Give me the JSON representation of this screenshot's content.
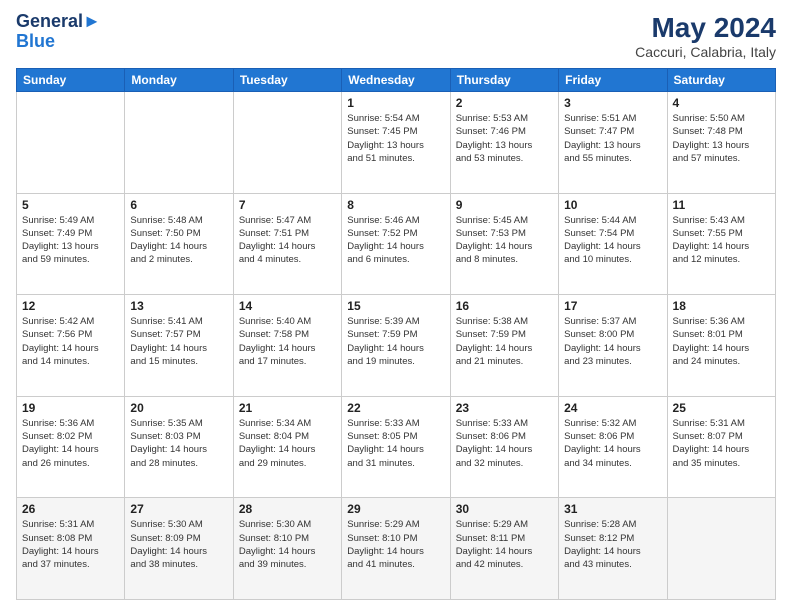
{
  "header": {
    "logo_line1": "General",
    "logo_line2": "Blue",
    "month_year": "May 2024",
    "location": "Caccuri, Calabria, Italy"
  },
  "weekdays": [
    "Sunday",
    "Monday",
    "Tuesday",
    "Wednesday",
    "Thursday",
    "Friday",
    "Saturday"
  ],
  "weeks": [
    [
      {
        "day": "",
        "info": ""
      },
      {
        "day": "",
        "info": ""
      },
      {
        "day": "",
        "info": ""
      },
      {
        "day": "1",
        "info": "Sunrise: 5:54 AM\nSunset: 7:45 PM\nDaylight: 13 hours\nand 51 minutes."
      },
      {
        "day": "2",
        "info": "Sunrise: 5:53 AM\nSunset: 7:46 PM\nDaylight: 13 hours\nand 53 minutes."
      },
      {
        "day": "3",
        "info": "Sunrise: 5:51 AM\nSunset: 7:47 PM\nDaylight: 13 hours\nand 55 minutes."
      },
      {
        "day": "4",
        "info": "Sunrise: 5:50 AM\nSunset: 7:48 PM\nDaylight: 13 hours\nand 57 minutes."
      }
    ],
    [
      {
        "day": "5",
        "info": "Sunrise: 5:49 AM\nSunset: 7:49 PM\nDaylight: 13 hours\nand 59 minutes."
      },
      {
        "day": "6",
        "info": "Sunrise: 5:48 AM\nSunset: 7:50 PM\nDaylight: 14 hours\nand 2 minutes."
      },
      {
        "day": "7",
        "info": "Sunrise: 5:47 AM\nSunset: 7:51 PM\nDaylight: 14 hours\nand 4 minutes."
      },
      {
        "day": "8",
        "info": "Sunrise: 5:46 AM\nSunset: 7:52 PM\nDaylight: 14 hours\nand 6 minutes."
      },
      {
        "day": "9",
        "info": "Sunrise: 5:45 AM\nSunset: 7:53 PM\nDaylight: 14 hours\nand 8 minutes."
      },
      {
        "day": "10",
        "info": "Sunrise: 5:44 AM\nSunset: 7:54 PM\nDaylight: 14 hours\nand 10 minutes."
      },
      {
        "day": "11",
        "info": "Sunrise: 5:43 AM\nSunset: 7:55 PM\nDaylight: 14 hours\nand 12 minutes."
      }
    ],
    [
      {
        "day": "12",
        "info": "Sunrise: 5:42 AM\nSunset: 7:56 PM\nDaylight: 14 hours\nand 14 minutes."
      },
      {
        "day": "13",
        "info": "Sunrise: 5:41 AM\nSunset: 7:57 PM\nDaylight: 14 hours\nand 15 minutes."
      },
      {
        "day": "14",
        "info": "Sunrise: 5:40 AM\nSunset: 7:58 PM\nDaylight: 14 hours\nand 17 minutes."
      },
      {
        "day": "15",
        "info": "Sunrise: 5:39 AM\nSunset: 7:59 PM\nDaylight: 14 hours\nand 19 minutes."
      },
      {
        "day": "16",
        "info": "Sunrise: 5:38 AM\nSunset: 7:59 PM\nDaylight: 14 hours\nand 21 minutes."
      },
      {
        "day": "17",
        "info": "Sunrise: 5:37 AM\nSunset: 8:00 PM\nDaylight: 14 hours\nand 23 minutes."
      },
      {
        "day": "18",
        "info": "Sunrise: 5:36 AM\nSunset: 8:01 PM\nDaylight: 14 hours\nand 24 minutes."
      }
    ],
    [
      {
        "day": "19",
        "info": "Sunrise: 5:36 AM\nSunset: 8:02 PM\nDaylight: 14 hours\nand 26 minutes."
      },
      {
        "day": "20",
        "info": "Sunrise: 5:35 AM\nSunset: 8:03 PM\nDaylight: 14 hours\nand 28 minutes."
      },
      {
        "day": "21",
        "info": "Sunrise: 5:34 AM\nSunset: 8:04 PM\nDaylight: 14 hours\nand 29 minutes."
      },
      {
        "day": "22",
        "info": "Sunrise: 5:33 AM\nSunset: 8:05 PM\nDaylight: 14 hours\nand 31 minutes."
      },
      {
        "day": "23",
        "info": "Sunrise: 5:33 AM\nSunset: 8:06 PM\nDaylight: 14 hours\nand 32 minutes."
      },
      {
        "day": "24",
        "info": "Sunrise: 5:32 AM\nSunset: 8:06 PM\nDaylight: 14 hours\nand 34 minutes."
      },
      {
        "day": "25",
        "info": "Sunrise: 5:31 AM\nSunset: 8:07 PM\nDaylight: 14 hours\nand 35 minutes."
      }
    ],
    [
      {
        "day": "26",
        "info": "Sunrise: 5:31 AM\nSunset: 8:08 PM\nDaylight: 14 hours\nand 37 minutes."
      },
      {
        "day": "27",
        "info": "Sunrise: 5:30 AM\nSunset: 8:09 PM\nDaylight: 14 hours\nand 38 minutes."
      },
      {
        "day": "28",
        "info": "Sunrise: 5:30 AM\nSunset: 8:10 PM\nDaylight: 14 hours\nand 39 minutes."
      },
      {
        "day": "29",
        "info": "Sunrise: 5:29 AM\nSunset: 8:10 PM\nDaylight: 14 hours\nand 41 minutes."
      },
      {
        "day": "30",
        "info": "Sunrise: 5:29 AM\nSunset: 8:11 PM\nDaylight: 14 hours\nand 42 minutes."
      },
      {
        "day": "31",
        "info": "Sunrise: 5:28 AM\nSunset: 8:12 PM\nDaylight: 14 hours\nand 43 minutes."
      },
      {
        "day": "",
        "info": ""
      }
    ]
  ]
}
